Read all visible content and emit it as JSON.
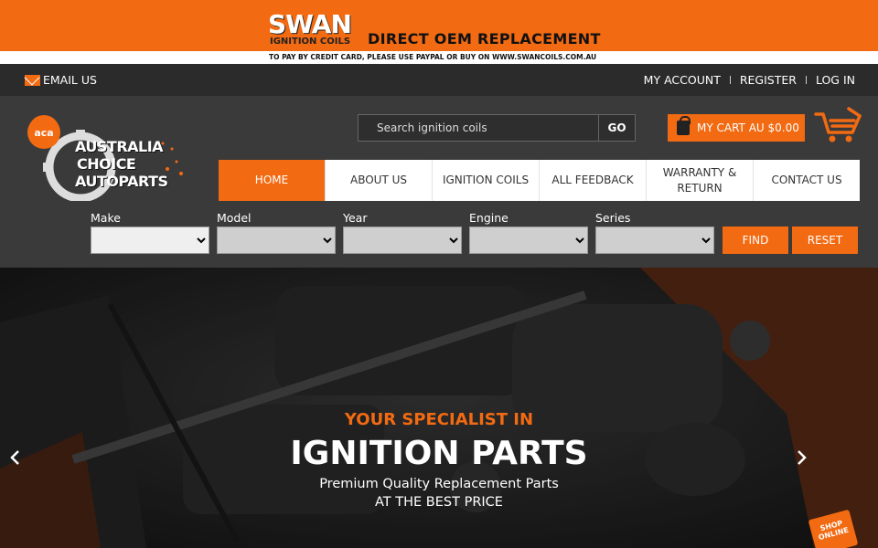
{
  "promo": {
    "brand": "SWAN",
    "brand_sub": "IGNITION COILS",
    "headline": "DIRECT OEM REPLACEMENT",
    "note": "TO PAY BY CREDIT CARD, PLEASE USE PAYPAL OR BUY ON WWW.SWANCOILS.COM.AU"
  },
  "topbar": {
    "email_label": "EMAIL US",
    "my_account": "MY ACCOUNT",
    "register": "REGISTER",
    "login": "LOG IN"
  },
  "logo": {
    "badge": "aca",
    "line1": "AUSTRALIA",
    "line2": "CHOICE",
    "line3": "AUTOPARTS"
  },
  "search": {
    "placeholder": "Search ignition coils",
    "button": "GO"
  },
  "cart": {
    "label": "MY CART AU $0.00"
  },
  "nav": {
    "items": [
      {
        "label": "HOME",
        "active": true
      },
      {
        "label": "ABOUT US"
      },
      {
        "label": "IGNITION COILS"
      },
      {
        "label": "ALL FEEDBACK"
      },
      {
        "label": "WARRANTY & RETURN"
      },
      {
        "label": "CONTACT US"
      }
    ]
  },
  "filters": {
    "make": "Make",
    "model": "Model",
    "year": "Year",
    "engine": "Engine",
    "series": "Series",
    "find": "FIND",
    "reset": "RESET"
  },
  "hero": {
    "kicker": "YOUR SPECIALIST IN",
    "title": "IGNITION PARTS",
    "sub1": "Premium Quality Replacement Parts",
    "sub2": "AT THE BEST PRICE",
    "badge": "SHOP ONLINE"
  },
  "colors": {
    "accent": "#f26a12",
    "dark": "#3a3a3a",
    "topbar": "#2b2b2b"
  }
}
